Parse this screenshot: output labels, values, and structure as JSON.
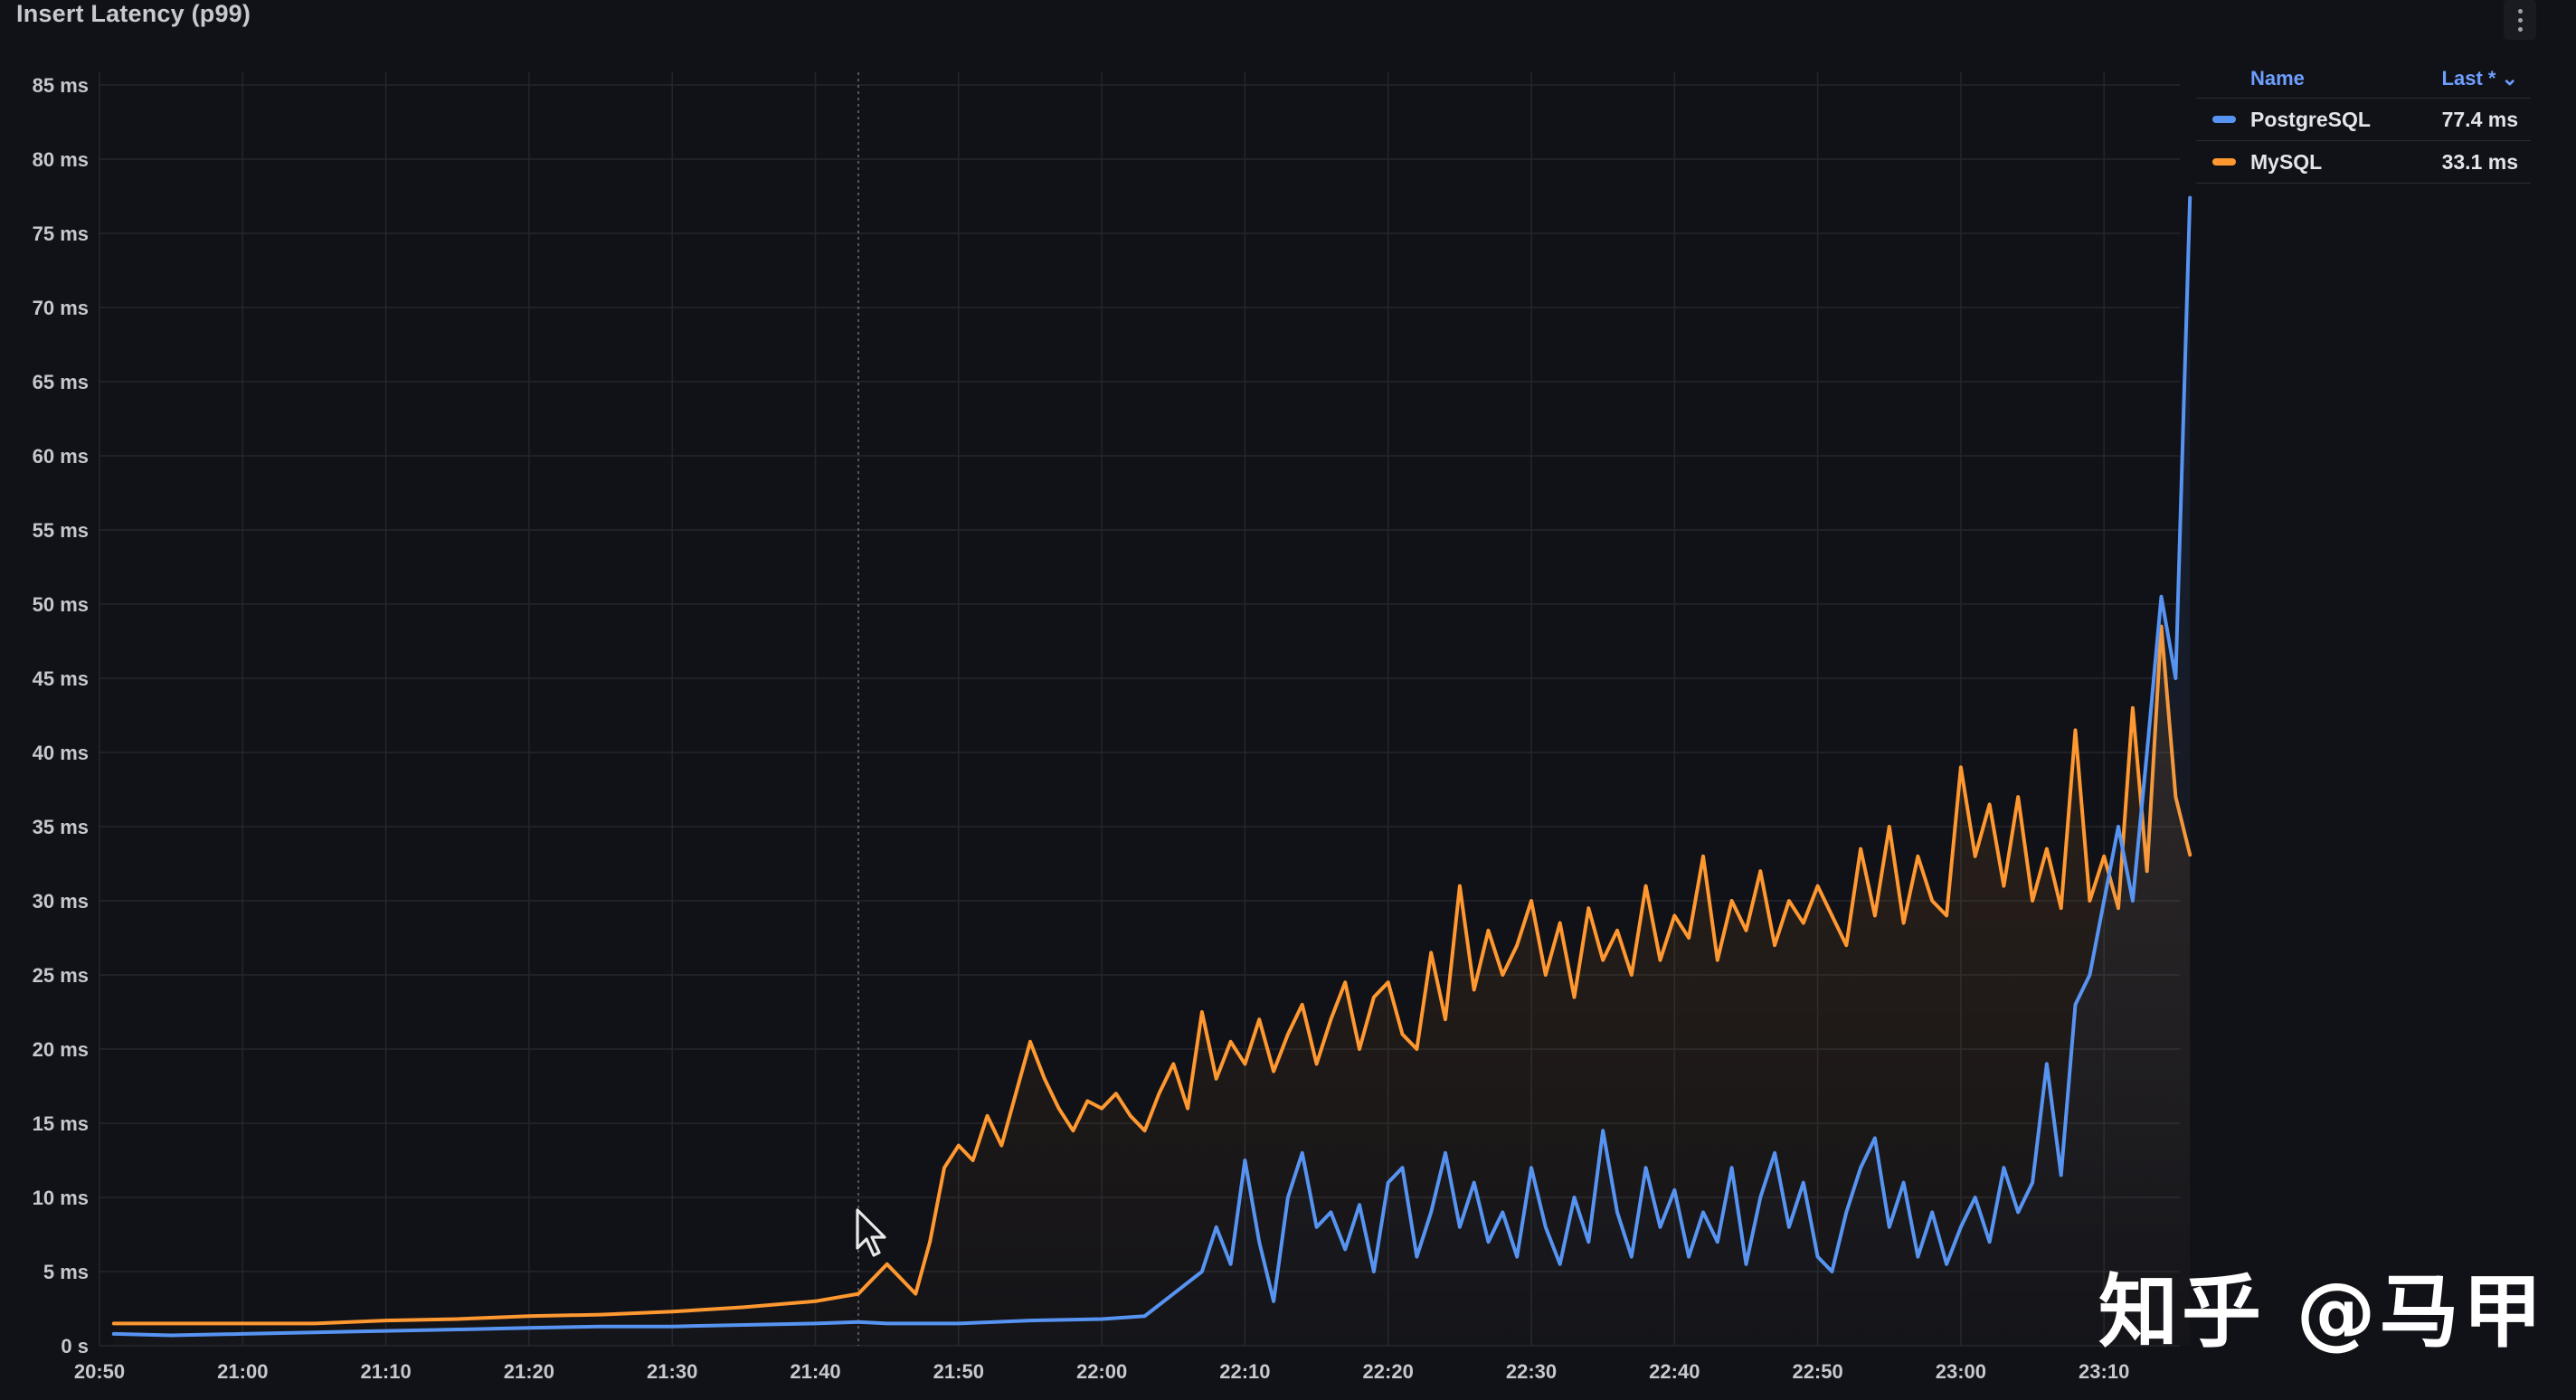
{
  "panel": {
    "title": "Insert Latency (p99)",
    "menu_icon": "kebab-menu-icon"
  },
  "legend": {
    "name_header": "Name",
    "value_header": "Last * ⌄",
    "items": [
      {
        "name": "PostgreSQL",
        "value": "77.4 ms",
        "color": "#5794f2"
      },
      {
        "name": "MySQL",
        "value": "33.1 ms",
        "color": "#ff9830"
      }
    ]
  },
  "watermark": "知乎 @马甲",
  "chart_data": {
    "type": "line",
    "title": "Insert Latency (p99)",
    "xlabel": "",
    "ylabel": "",
    "x_ticks": [
      "20:50",
      "21:00",
      "21:10",
      "21:20",
      "21:30",
      "21:40",
      "21:50",
      "22:00",
      "22:10",
      "22:20",
      "22:30",
      "22:40",
      "22:50",
      "23:00",
      "23:10"
    ],
    "y_ticks": [
      "0 s",
      "5 ms",
      "10 ms",
      "15 ms",
      "20 ms",
      "25 ms",
      "30 ms",
      "35 ms",
      "40 ms",
      "45 ms",
      "50 ms",
      "55 ms",
      "60 ms",
      "65 ms",
      "70 ms",
      "75 ms",
      "80 ms",
      "85 ms"
    ],
    "ylim": [
      0,
      85
    ],
    "grid": true,
    "legend_position": "top-right",
    "series": [
      {
        "name": "PostgreSQL",
        "color": "#5794f2",
        "points": [
          [
            "20:51",
            0.8
          ],
          [
            "20:55",
            0.7
          ],
          [
            "21:00",
            0.8
          ],
          [
            "21:05",
            0.9
          ],
          [
            "21:10",
            1.0
          ],
          [
            "21:15",
            1.1
          ],
          [
            "21:20",
            1.2
          ],
          [
            "21:25",
            1.3
          ],
          [
            "21:30",
            1.3
          ],
          [
            "21:35",
            1.4
          ],
          [
            "21:40",
            1.5
          ],
          [
            "21:43",
            1.6
          ],
          [
            "21:45",
            1.5
          ],
          [
            "21:50",
            1.5
          ],
          [
            "21:55",
            1.7
          ],
          [
            "22:00",
            1.8
          ],
          [
            "22:03",
            2.0
          ],
          [
            "22:05",
            3.5
          ],
          [
            "22:07",
            5.0
          ],
          [
            "22:08",
            8.0
          ],
          [
            "22:09",
            5.5
          ],
          [
            "22:10",
            12.5
          ],
          [
            "22:11",
            7.0
          ],
          [
            "22:12",
            3.0
          ],
          [
            "22:13",
            10.0
          ],
          [
            "22:14",
            13.0
          ],
          [
            "22:15",
            8.0
          ],
          [
            "22:16",
            9.0
          ],
          [
            "22:17",
            6.5
          ],
          [
            "22:18",
            9.5
          ],
          [
            "22:19",
            5.0
          ],
          [
            "22:20",
            11.0
          ],
          [
            "22:21",
            12.0
          ],
          [
            "22:22",
            6.0
          ],
          [
            "22:23",
            9.0
          ],
          [
            "22:24",
            13.0
          ],
          [
            "22:25",
            8.0
          ],
          [
            "22:26",
            11.0
          ],
          [
            "22:27",
            7.0
          ],
          [
            "22:28",
            9.0
          ],
          [
            "22:29",
            6.0
          ],
          [
            "22:30",
            12.0
          ],
          [
            "22:31",
            8.0
          ],
          [
            "22:32",
            5.5
          ],
          [
            "22:33",
            10.0
          ],
          [
            "22:34",
            7.0
          ],
          [
            "22:35",
            14.5
          ],
          [
            "22:36",
            9.0
          ],
          [
            "22:37",
            6.0
          ],
          [
            "22:38",
            12.0
          ],
          [
            "22:39",
            8.0
          ],
          [
            "22:40",
            10.5
          ],
          [
            "22:41",
            6.0
          ],
          [
            "22:42",
            9.0
          ],
          [
            "22:43",
            7.0
          ],
          [
            "22:44",
            12.0
          ],
          [
            "22:45",
            5.5
          ],
          [
            "22:46",
            10.0
          ],
          [
            "22:47",
            13.0
          ],
          [
            "22:48",
            8.0
          ],
          [
            "22:49",
            11.0
          ],
          [
            "22:50",
            6.0
          ],
          [
            "22:51",
            5.0
          ],
          [
            "22:52",
            9.0
          ],
          [
            "22:53",
            12.0
          ],
          [
            "22:54",
            14.0
          ],
          [
            "22:55",
            8.0
          ],
          [
            "22:56",
            11.0
          ],
          [
            "22:57",
            6.0
          ],
          [
            "22:58",
            9.0
          ],
          [
            "22:59",
            5.5
          ],
          [
            "23:00",
            8.0
          ],
          [
            "23:01",
            10.0
          ],
          [
            "23:02",
            7.0
          ],
          [
            "23:03",
            12.0
          ],
          [
            "23:04",
            9.0
          ],
          [
            "23:05",
            11.0
          ],
          [
            "23:06",
            19.0
          ],
          [
            "23:07",
            11.5
          ],
          [
            "23:08",
            23.0
          ],
          [
            "23:09",
            25.0
          ],
          [
            "23:10",
            30.0
          ],
          [
            "23:11",
            35.0
          ],
          [
            "23:12",
            30.0
          ],
          [
            "23:13",
            40.0
          ],
          [
            "23:14",
            50.5
          ],
          [
            "23:15",
            45.0
          ],
          [
            "23:16",
            77.4
          ]
        ]
      },
      {
        "name": "MySQL",
        "color": "#ff9830",
        "points": [
          [
            "20:51",
            1.5
          ],
          [
            "20:55",
            1.5
          ],
          [
            "21:00",
            1.5
          ],
          [
            "21:05",
            1.5
          ],
          [
            "21:10",
            1.7
          ],
          [
            "21:15",
            1.8
          ],
          [
            "21:20",
            2.0
          ],
          [
            "21:25",
            2.1
          ],
          [
            "21:30",
            2.3
          ],
          [
            "21:35",
            2.6
          ],
          [
            "21:40",
            3.0
          ],
          [
            "21:43",
            3.5
          ],
          [
            "21:45",
            5.5
          ],
          [
            "21:47",
            3.5
          ],
          [
            "21:48",
            7.0
          ],
          [
            "21:49",
            12.0
          ],
          [
            "21:50",
            13.5
          ],
          [
            "21:51",
            12.5
          ],
          [
            "21:52",
            15.5
          ],
          [
            "21:53",
            13.5
          ],
          [
            "21:54",
            17.0
          ],
          [
            "21:55",
            20.5
          ],
          [
            "21:56",
            18.0
          ],
          [
            "21:57",
            16.0
          ],
          [
            "21:58",
            14.5
          ],
          [
            "21:59",
            16.5
          ],
          [
            "22:00",
            16.0
          ],
          [
            "22:01",
            17.0
          ],
          [
            "22:02",
            15.5
          ],
          [
            "22:03",
            14.5
          ],
          [
            "22:04",
            17.0
          ],
          [
            "22:05",
            19.0
          ],
          [
            "22:06",
            16.0
          ],
          [
            "22:07",
            22.5
          ],
          [
            "22:08",
            18.0
          ],
          [
            "22:09",
            20.5
          ],
          [
            "22:10",
            19.0
          ],
          [
            "22:11",
            22.0
          ],
          [
            "22:12",
            18.5
          ],
          [
            "22:13",
            21.0
          ],
          [
            "22:14",
            23.0
          ],
          [
            "22:15",
            19.0
          ],
          [
            "22:16",
            22.0
          ],
          [
            "22:17",
            24.5
          ],
          [
            "22:18",
            20.0
          ],
          [
            "22:19",
            23.5
          ],
          [
            "22:20",
            24.5
          ],
          [
            "22:21",
            21.0
          ],
          [
            "22:22",
            20.0
          ],
          [
            "22:23",
            26.5
          ],
          [
            "22:24",
            22.0
          ],
          [
            "22:25",
            31.0
          ],
          [
            "22:26",
            24.0
          ],
          [
            "22:27",
            28.0
          ],
          [
            "22:28",
            25.0
          ],
          [
            "22:29",
            27.0
          ],
          [
            "22:30",
            30.0
          ],
          [
            "22:31",
            25.0
          ],
          [
            "22:32",
            28.5
          ],
          [
            "22:33",
            23.5
          ],
          [
            "22:34",
            29.5
          ],
          [
            "22:35",
            26.0
          ],
          [
            "22:36",
            28.0
          ],
          [
            "22:37",
            25.0
          ],
          [
            "22:38",
            31.0
          ],
          [
            "22:39",
            26.0
          ],
          [
            "22:40",
            29.0
          ],
          [
            "22:41",
            27.5
          ],
          [
            "22:42",
            33.0
          ],
          [
            "22:43",
            26.0
          ],
          [
            "22:44",
            30.0
          ],
          [
            "22:45",
            28.0
          ],
          [
            "22:46",
            32.0
          ],
          [
            "22:47",
            27.0
          ],
          [
            "22:48",
            30.0
          ],
          [
            "22:49",
            28.5
          ],
          [
            "22:50",
            31.0
          ],
          [
            "22:51",
            29.0
          ],
          [
            "22:52",
            27.0
          ],
          [
            "22:53",
            33.5
          ],
          [
            "22:54",
            29.0
          ],
          [
            "22:55",
            35.0
          ],
          [
            "22:56",
            28.5
          ],
          [
            "22:57",
            33.0
          ],
          [
            "22:58",
            30.0
          ],
          [
            "22:59",
            29.0
          ],
          [
            "23:00",
            39.0
          ],
          [
            "23:01",
            33.0
          ],
          [
            "23:02",
            36.5
          ],
          [
            "23:03",
            31.0
          ],
          [
            "23:04",
            37.0
          ],
          [
            "23:05",
            30.0
          ],
          [
            "23:06",
            33.5
          ],
          [
            "23:07",
            29.5
          ],
          [
            "23:08",
            41.5
          ],
          [
            "23:09",
            30.0
          ],
          [
            "23:10",
            33.0
          ],
          [
            "23:11",
            29.5
          ],
          [
            "23:12",
            43.0
          ],
          [
            "23:13",
            32.0
          ],
          [
            "23:14",
            48.5
          ],
          [
            "23:15",
            37.0
          ],
          [
            "23:16",
            33.1
          ]
        ]
      }
    ]
  }
}
